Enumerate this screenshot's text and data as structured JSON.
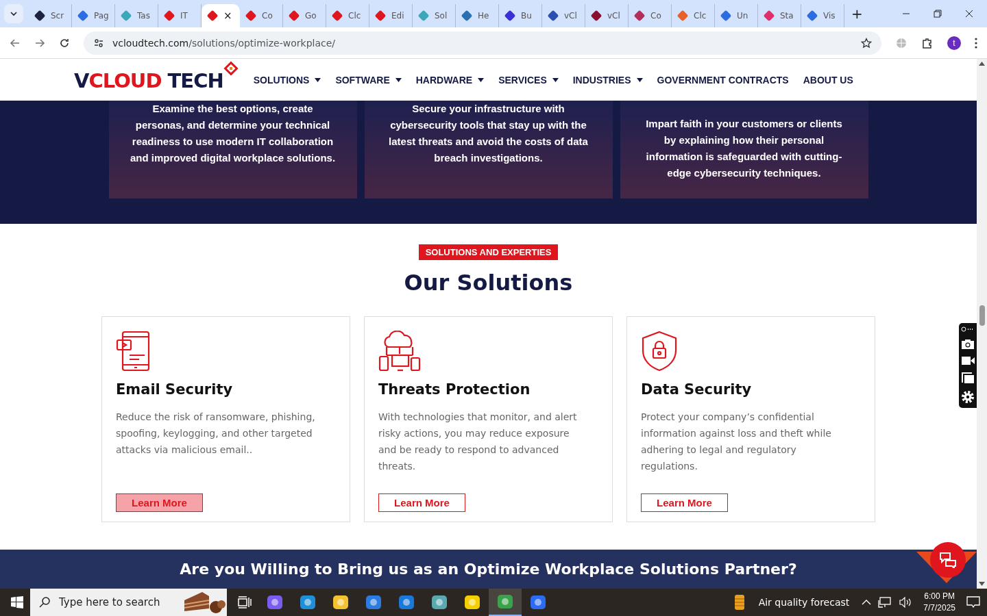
{
  "browser": {
    "tabs": [
      {
        "title": "Scr",
        "selected": false
      },
      {
        "title": "Pag",
        "selected": false
      },
      {
        "title": "Tas",
        "selected": false
      },
      {
        "title": "IT",
        "selected": false
      },
      {
        "title": "×",
        "selected": true
      },
      {
        "title": "Co",
        "selected": false
      },
      {
        "title": "Go",
        "selected": false
      },
      {
        "title": "Clc",
        "selected": false
      },
      {
        "title": "Edi",
        "selected": false
      },
      {
        "title": "Sol",
        "selected": false
      },
      {
        "title": "He",
        "selected": false
      },
      {
        "title": "Bu",
        "selected": false
      },
      {
        "title": "vCl",
        "selected": false
      },
      {
        "title": "vCl",
        "selected": false
      },
      {
        "title": "Co",
        "selected": false
      },
      {
        "title": "Clc",
        "selected": false
      },
      {
        "title": "Un",
        "selected": false
      },
      {
        "title": "Sta",
        "selected": false
      },
      {
        "title": "Vis",
        "selected": false
      }
    ],
    "new_tab": "+",
    "url_host": "vcloudtech.com",
    "url_path": "/solutions/optimize-workplace/",
    "profile": "t"
  },
  "site": {
    "logo": [
      {
        "text": "V",
        "color": "#141a44"
      },
      {
        "text": "CLOUD",
        "color": "#e0161e"
      },
      {
        "text": " TECH",
        "color": "#141a44"
      }
    ],
    "nav": [
      {
        "label": "SOLUTIONS",
        "dropdown": true
      },
      {
        "label": "SOFTWARE",
        "dropdown": true
      },
      {
        "label": "HARDWARE",
        "dropdown": true
      },
      {
        "label": "SERVICES",
        "dropdown": true
      },
      {
        "label": "INDUSTRIES",
        "dropdown": true
      },
      {
        "label": "GOVERNMENT CONTRACTS",
        "dropdown": false
      },
      {
        "label": "ABOUT US",
        "dropdown": false
      }
    ],
    "top_cards": [
      "Examine the best options, create personas, and determine your technical readiness to use modern IT collaboration and improved digital workplace solutions.",
      "Secure your infrastructure with cybersecurity tools that stay up with the latest threats and avoid the costs of data breach investigations.",
      "Impart faith in your customers or clients by explaining how their personal information is safeguarded with cutting-edge cybersecurity techniques."
    ],
    "badge": "SOLUTIONS AND EXPERTIES",
    "heading": "Our Solutions",
    "solutions": [
      {
        "kind": "email",
        "title": "Email Security",
        "text": "Reduce the risk of ransomware, phishing, spoofing, keylogging, and other targeted attacks via malicious email..",
        "button": "Learn More",
        "hovered": true
      },
      {
        "kind": "cloud",
        "title": "Threats Protection",
        "text": "With technologies that monitor, and alert risky actions, you may reduce exposure and be ready to respond to advanced threats.",
        "button": "Learn More",
        "hovered": false
      },
      {
        "kind": "shield",
        "title": "Data Security",
        "text": "Protect your company’s confidential information against loss and theft while adhering to legal and regulatory regulations.",
        "button": "Learn More",
        "hovered": false
      }
    ],
    "banner": "Are you Willing to Bring us as an Optimize Workplace Solutions Partner?"
  },
  "taskbar": {
    "search_placeholder": "Type here to search",
    "weather": "Air quality forecast",
    "time": "6:00 PM",
    "date": "7/7/2025"
  }
}
